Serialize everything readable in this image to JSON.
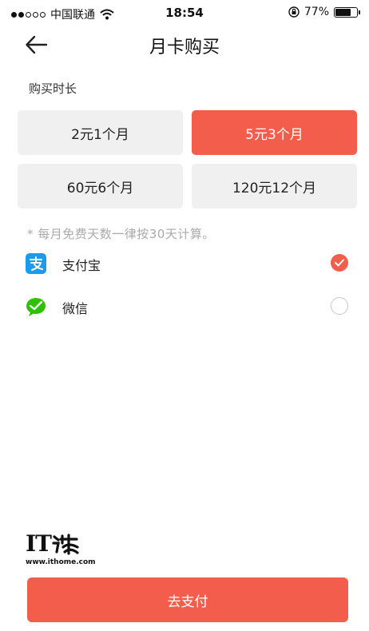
{
  "status_bar": {
    "carrier": "中国联通",
    "time": "18:54",
    "battery": "77%",
    "battery_level": 0.77
  },
  "header": {
    "title": "月卡购买",
    "back_icon": "back-arrow-icon"
  },
  "duration": {
    "label": "购买时长",
    "plans": [
      {
        "label": "2元1个月",
        "selected": false
      },
      {
        "label": "5元3个月",
        "selected": true
      },
      {
        "label": "60元6个月",
        "selected": false
      },
      {
        "label": "120元12个月",
        "selected": false
      }
    ],
    "note": "* 每月免费天数一律按30天计算。"
  },
  "payment": {
    "methods": [
      {
        "label": "支付宝",
        "icon": "alipay-icon",
        "selected": true
      },
      {
        "label": "微信",
        "icon": "wechat-icon",
        "selected": false
      }
    ]
  },
  "watermark": {
    "logo_text": "IT",
    "url": "www.ithome.com"
  },
  "footer": {
    "pay_button": "去支付"
  },
  "colors": {
    "accent": "#f25e4b",
    "plan_bg": "#f0f0f0",
    "alipay": "#1e9be8",
    "wechat": "#2dc100"
  }
}
